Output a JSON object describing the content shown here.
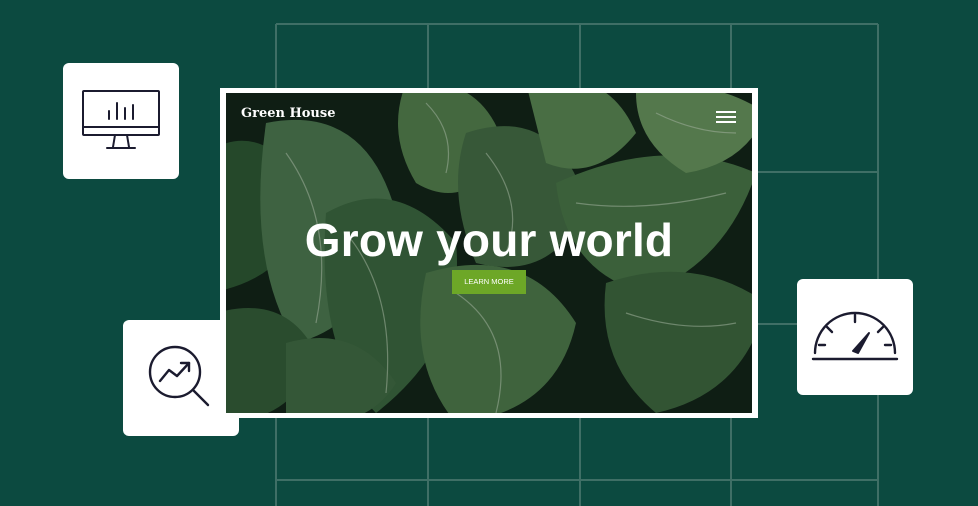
{
  "background_color": "#0c4a40",
  "icons": {
    "monitor": "monitor-chart-icon",
    "analytics": "magnifier-trend-icon",
    "speed": "speedometer-icon"
  },
  "site": {
    "brand": "Green House",
    "headline": "Grow your world",
    "cta_label": "LEARN MORE",
    "menu_icon": "hamburger-menu-icon",
    "accent_color": "#6da727"
  }
}
